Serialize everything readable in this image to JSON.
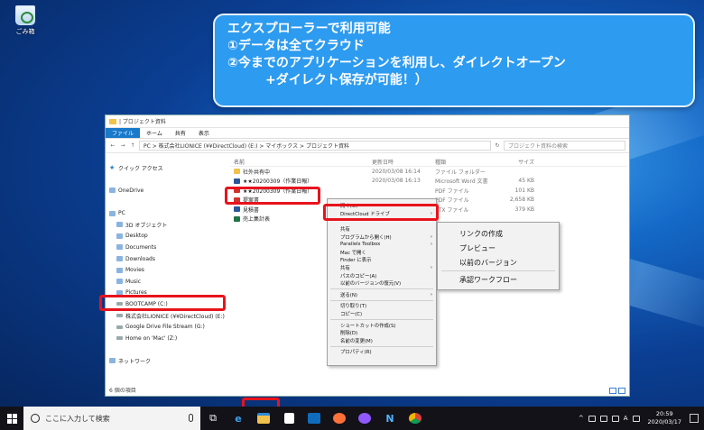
{
  "desktop": {
    "recycle_bin_label": "ごみ箱"
  },
  "callout": {
    "line1": "エクスプローラーで利用可能",
    "line2": "①データは全てクラウド",
    "line3": "②今までのアプリケーションを利用し、ダイレクトオープン",
    "line4": "+ダイレクト保存が可能！）"
  },
  "explorer": {
    "title": "| プロジェクト資料",
    "ribbon_tabs": [
      "ファイル",
      "ホーム",
      "共有",
      "表示"
    ],
    "path": "PC  >  株式会社LIONICE (¥¥DirectCloud) (E:)  >  マイボックス  >  プロジェクト資料",
    "search_placeholder": "プロジェクト資料の検索",
    "sidebar": [
      {
        "label": "クイック アクセス",
        "icon": "star-icon"
      },
      {
        "label": "",
        "icon": ""
      },
      {
        "label": "OneDrive",
        "icon": "cloud-icon"
      },
      {
        "label": "",
        "icon": ""
      },
      {
        "label": "PC",
        "icon": "pc-icon"
      },
      {
        "label": "3D オブジェクト",
        "icon": "folder-icon"
      },
      {
        "label": "Desktop",
        "icon": "folder-icon"
      },
      {
        "label": "Documents",
        "icon": "folder-icon"
      },
      {
        "label": "Downloads",
        "icon": "folder-icon"
      },
      {
        "label": "Movies",
        "icon": "folder-icon"
      },
      {
        "label": "Music",
        "icon": "folder-icon"
      },
      {
        "label": "Pictures",
        "icon": "folder-icon"
      },
      {
        "label": "BOOTCAMP (C:)",
        "icon": "drive-icon"
      },
      {
        "label": "株式会社LIONICE (¥¥DirectCloud) (E:)",
        "icon": "drive-icon"
      },
      {
        "label": "Google Drive File Stream (G:)",
        "icon": "drive-icon"
      },
      {
        "label": "Home on 'Mac' (Z:)",
        "icon": "drive-icon"
      },
      {
        "label": "",
        "icon": ""
      },
      {
        "label": "ネットワーク",
        "icon": "network-icon"
      }
    ],
    "columns": [
      "名前",
      "更新日時",
      "種類",
      "サイズ"
    ],
    "files": [
      {
        "name": "社外共有中",
        "date": "2020/03/08 16:14",
        "type": "ファイル フォルダー",
        "size": "",
        "color": "#f0c14b"
      },
      {
        "name": "★★20200309（作業日報）",
        "date": "2020/03/08 16:13",
        "type": "Microsoft Word 文書",
        "size": "45 KB",
        "color": "#2b579a"
      },
      {
        "name": "★★20200309（作業日報）",
        "date": "",
        "type": "PDF ファイル",
        "size": "101 KB",
        "color": "#d0342c"
      },
      {
        "name": "提案書",
        "date": "",
        "type": "PDF ファイル",
        "size": "2,658 KB",
        "color": "#d0342c"
      },
      {
        "name": "見積書",
        "date": "",
        "type": "RTX ファイル",
        "size": "379 KB",
        "color": "#2b579a"
      },
      {
        "name": "売上集計表",
        "date": "",
        "type": "",
        "size": "",
        "color": "#217346"
      }
    ],
    "status": "6 個の項目"
  },
  "context_menu": {
    "items": [
      {
        "label": "開く(O)",
        "arrow": ""
      },
      {
        "label": "DirectCloud ドライブ",
        "arrow": "›"
      },
      {
        "label": "",
        "arrow": ""
      },
      {
        "label": "共有",
        "arrow": ""
      },
      {
        "label": "プログラムから開く(H)",
        "arrow": "›"
      },
      {
        "label": "Parallels Toolbox",
        "arrow": "›"
      },
      {
        "label": "Mac で開く",
        "arrow": ""
      },
      {
        "label": "Finder に表示",
        "arrow": ""
      },
      {
        "label": "共有",
        "arrow": "›"
      },
      {
        "label": "パスのコピー(A)",
        "arrow": ""
      },
      {
        "label": "以前のバージョンの復元(V)",
        "arrow": ""
      },
      {
        "label": "---",
        "arrow": ""
      },
      {
        "label": "送る(N)",
        "arrow": "›"
      },
      {
        "label": "---",
        "arrow": ""
      },
      {
        "label": "切り取り(T)",
        "arrow": ""
      },
      {
        "label": "コピー(C)",
        "arrow": ""
      },
      {
        "label": "---",
        "arrow": ""
      },
      {
        "label": "ショートカットの作成(S)",
        "arrow": ""
      },
      {
        "label": "削除(D)",
        "arrow": ""
      },
      {
        "label": "名前の変更(M)",
        "arrow": ""
      },
      {
        "label": "---",
        "arrow": ""
      },
      {
        "label": "プロパティ(R)",
        "arrow": ""
      }
    ]
  },
  "submenu": {
    "items": [
      "リンクの作成",
      "プレビュー",
      "以前のバージョン",
      "---",
      "承認ワークフロー"
    ]
  },
  "taskbar": {
    "search_placeholder": "ここに入力して検索",
    "time": "20:59",
    "date": "2020/03/17",
    "lang": "A"
  },
  "colors": {
    "highlight": "#e8131c",
    "callout": "#2d9bf0",
    "ribbon_file": "#1979ca"
  }
}
